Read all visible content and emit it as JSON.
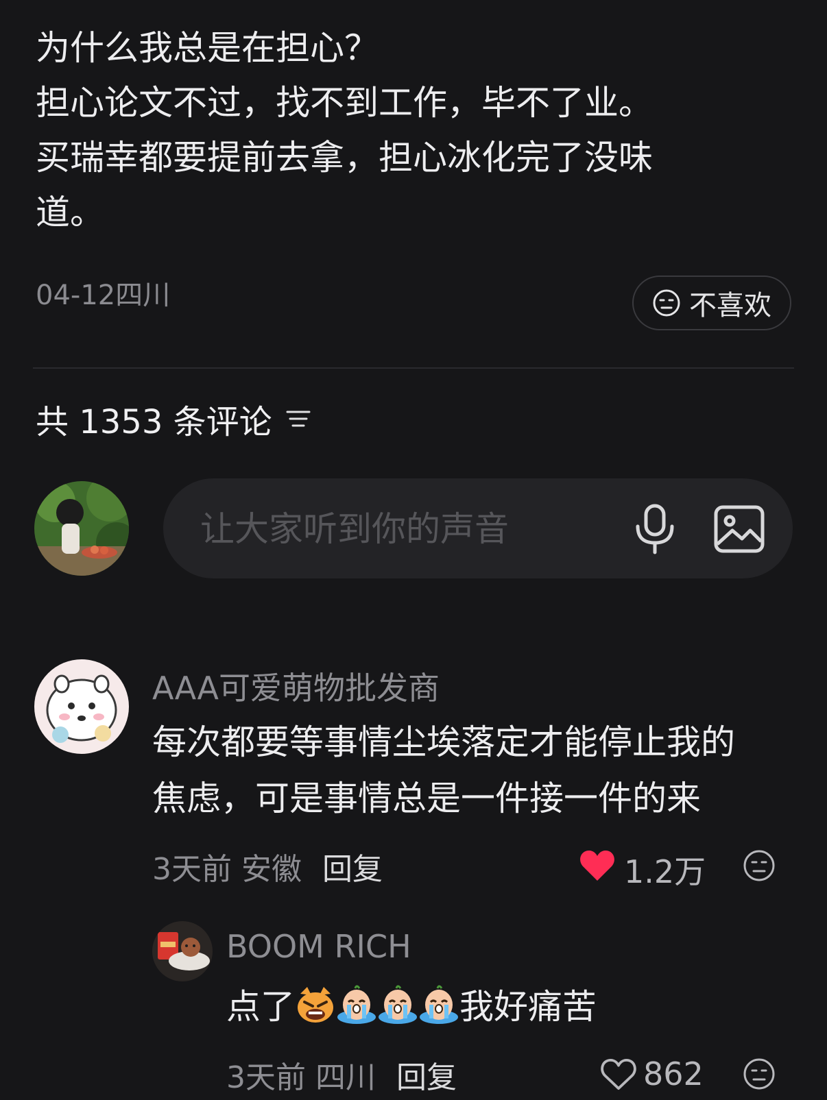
{
  "post": {
    "lines": [
      "为什么我总是在担心？",
      "担心论文不过，找不到工作，毕不了业。",
      "买瑞幸都要提前去拿，担心冰化完了没味",
      "道。"
    ],
    "date_location": "04-12四川",
    "dislike_label": "不喜欢"
  },
  "comments_header": {
    "label": "共 1353 条评论"
  },
  "composer": {
    "placeholder": "让大家听到你的声音"
  },
  "comments": [
    {
      "username": "AAA可爱萌物批发商",
      "lines": [
        "每次都要等事情尘埃落定才能停止我的",
        "焦虑，可是事情总是一件接一件的来"
      ],
      "time_location": "3天前 安徽",
      "reply_label": "回复",
      "likes": "1.2万",
      "liked": true,
      "replies": [
        {
          "username": "BOOM RICH",
          "text_prefix": "点了",
          "emojis": [
            "angry-cat-emoji",
            "crying-emoji",
            "crying-emoji",
            "crying-emoji"
          ],
          "text_suffix": "我好痛苦",
          "time_location": "3天前 四川",
          "reply_label": "回复",
          "likes": "862"
        }
      ]
    }
  ],
  "colors": {
    "background": "#161618",
    "like_red": "#ff2d55",
    "muted_text": "#8e8e93"
  }
}
